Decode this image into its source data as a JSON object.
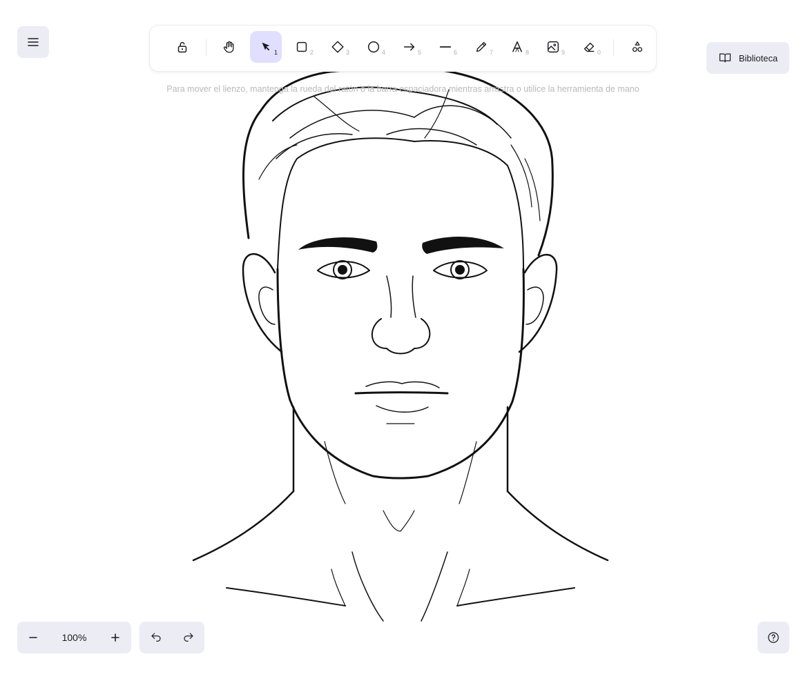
{
  "toolbar": {
    "tools": [
      {
        "name": "lock",
        "icon": "lock-open-icon",
        "shortcut": ""
      },
      {
        "name": "hand",
        "icon": "hand-icon",
        "shortcut": ""
      },
      {
        "name": "selection",
        "icon": "pointer-icon",
        "shortcut": "1"
      },
      {
        "name": "rectangle",
        "icon": "square-icon",
        "shortcut": "2"
      },
      {
        "name": "diamond",
        "icon": "diamond-icon",
        "shortcut": "3"
      },
      {
        "name": "ellipse",
        "icon": "circle-icon",
        "shortcut": "4"
      },
      {
        "name": "arrow",
        "icon": "arrow-right-icon",
        "shortcut": "5"
      },
      {
        "name": "line",
        "icon": "line-icon",
        "shortcut": "6"
      },
      {
        "name": "draw",
        "icon": "pencil-icon",
        "shortcut": "7"
      },
      {
        "name": "text",
        "icon": "text-icon",
        "shortcut": "8"
      },
      {
        "name": "image",
        "icon": "image-icon",
        "shortcut": "9"
      },
      {
        "name": "eraser",
        "icon": "eraser-icon",
        "shortcut": "0"
      },
      {
        "name": "more-shapes",
        "icon": "shapes-icon",
        "shortcut": ""
      }
    ],
    "selected_tool": "selection"
  },
  "hint": "Para mover el lienzo, mantenga la rueda del ratón o la barra espaciadora mientras arrastra o utilice la herramienta de mano",
  "library": {
    "label": "Biblioteca"
  },
  "zoom": {
    "value": "100%"
  },
  "colors": {
    "accent": "#e0dfff",
    "island_bg": "#ececf4",
    "hint_text": "#b8b8bf"
  }
}
